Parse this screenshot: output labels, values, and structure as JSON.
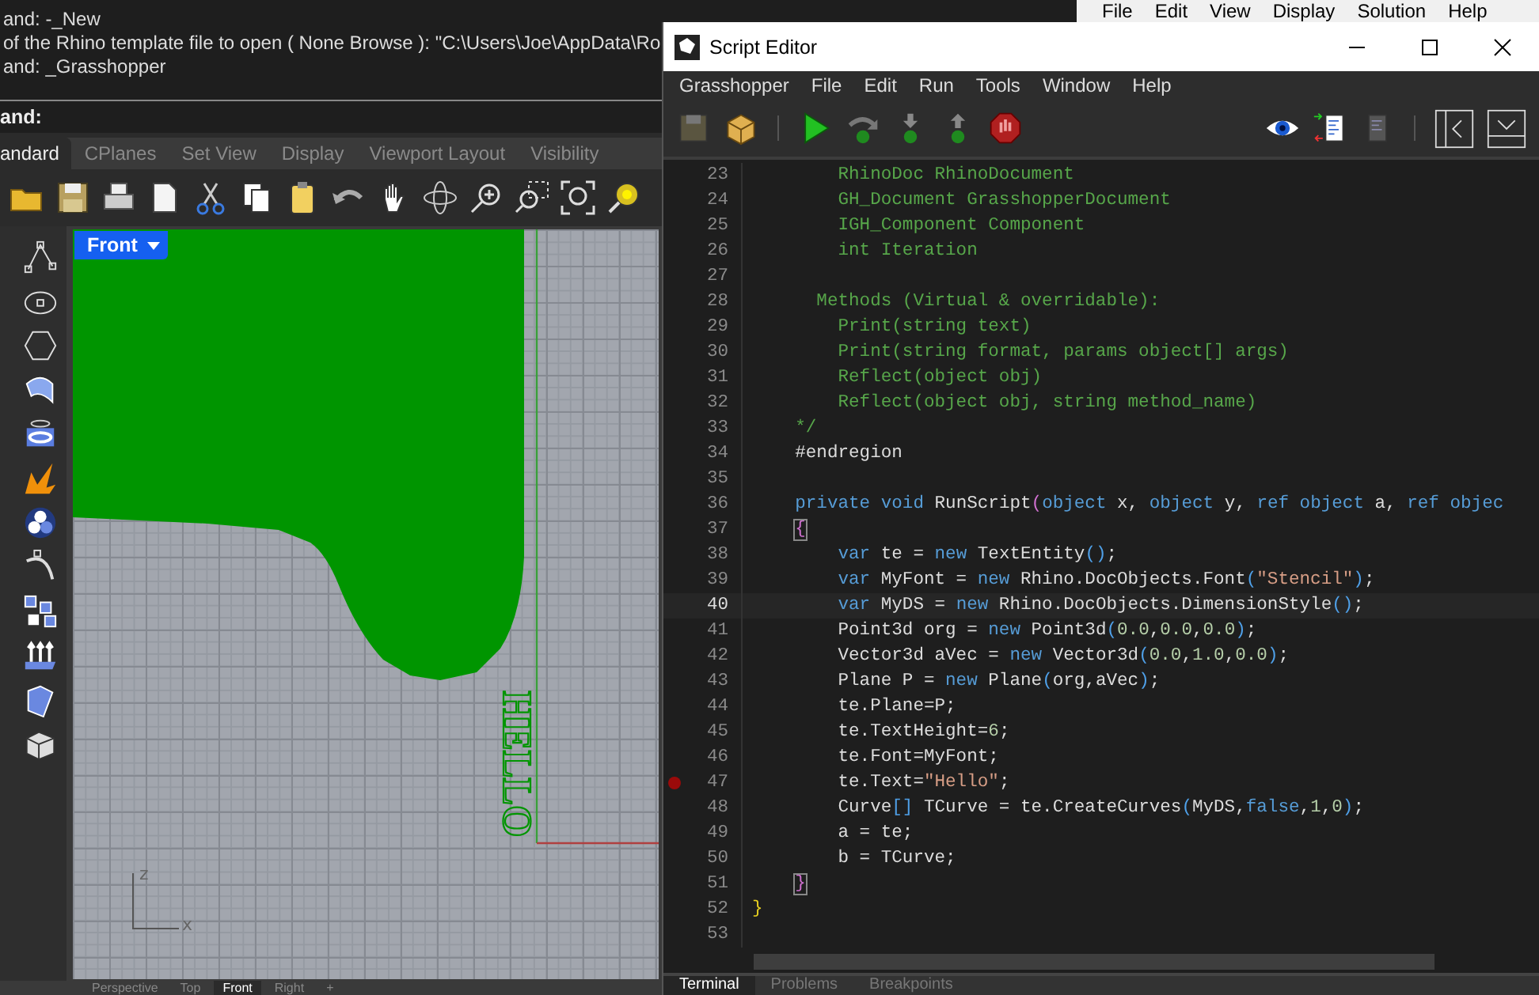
{
  "rhino": {
    "command_history": [
      "and: -_New",
      "of the Rhino template file to open ( None  Browse ): \"C:\\Users\\Joe\\AppData\\Ro",
      "and: _Grasshopper"
    ],
    "command_prompt": "and:",
    "toolbar_tabs": [
      {
        "label": "andard",
        "selected": true
      },
      {
        "label": "CPlanes",
        "selected": false
      },
      {
        "label": "Set View",
        "selected": false
      },
      {
        "label": "Display",
        "selected": false
      },
      {
        "label": "Viewport Layout",
        "selected": false
      },
      {
        "label": "Visibility",
        "selected": false
      }
    ],
    "viewport": {
      "label": "Front",
      "model_text": "HELLO",
      "axis_z": "z",
      "axis_x": "x"
    },
    "viewport_tabs": [
      {
        "label": "Perspective",
        "selected": false
      },
      {
        "label": "Top",
        "selected": false
      },
      {
        "label": "Front",
        "selected": true
      },
      {
        "label": "Right",
        "selected": false
      },
      {
        "label": "+",
        "selected": false
      }
    ]
  },
  "grasshopper_menu": [
    "File",
    "Edit",
    "View",
    "Display",
    "Solution",
    "Help"
  ],
  "script_editor": {
    "title": "Script Editor",
    "menu": [
      "Grasshopper",
      "File",
      "Edit",
      "Run",
      "Tools",
      "Window",
      "Help"
    ],
    "lines": [
      {
        "n": "23",
        "breakpoint": false,
        "current": false,
        "tokens": [
          {
            "kind": "comment",
            "text": "        RhinoDoc RhinoDocument"
          }
        ]
      },
      {
        "n": "24",
        "breakpoint": false,
        "current": false,
        "tokens": [
          {
            "kind": "comment",
            "text": "        GH_Document GrasshopperDocument"
          }
        ]
      },
      {
        "n": "25",
        "breakpoint": false,
        "current": false,
        "tokens": [
          {
            "kind": "comment",
            "text": "        IGH_Component Component"
          }
        ]
      },
      {
        "n": "26",
        "breakpoint": false,
        "current": false,
        "tokens": [
          {
            "kind": "comment",
            "text": "        int Iteration"
          }
        ]
      },
      {
        "n": "27",
        "breakpoint": false,
        "current": false
      },
      {
        "n": "28",
        "breakpoint": false,
        "current": false,
        "tokens": [
          {
            "kind": "comment",
            "text": "      Methods (Virtual & overridable):"
          }
        ]
      },
      {
        "n": "29",
        "breakpoint": false,
        "current": false,
        "tokens": [
          {
            "kind": "comment",
            "text": "        Print(string text)"
          }
        ]
      },
      {
        "n": "30",
        "breakpoint": false,
        "current": false,
        "tokens": [
          {
            "kind": "comment",
            "text": "        Print(string format, params object[] args)"
          }
        ]
      },
      {
        "n": "31",
        "breakpoint": false,
        "current": false,
        "tokens": [
          {
            "kind": "comment",
            "text": "        Reflect(object obj)"
          }
        ]
      },
      {
        "n": "32",
        "breakpoint": false,
        "current": false,
        "tokens": [
          {
            "kind": "comment",
            "text": "        Reflect(object obj, string method_name)"
          }
        ]
      },
      {
        "n": "33",
        "breakpoint": false,
        "current": false,
        "tokens": [
          {
            "kind": "comment",
            "text": "    */"
          }
        ]
      },
      {
        "n": "34",
        "breakpoint": false,
        "current": false,
        "tokens": [
          {
            "kind": "plain",
            "text": "    #endregion"
          }
        ]
      },
      {
        "n": "35",
        "breakpoint": false,
        "current": false
      },
      {
        "n": "36",
        "breakpoint": false,
        "current": false,
        "tokens": [
          {
            "kind": "keyword",
            "text": "    private"
          },
          {
            "kind": "keyword",
            "text": " void"
          },
          {
            "kind": "plain",
            "text": " RunScript"
          },
          {
            "kind": "paren",
            "text": "("
          },
          {
            "kind": "keyword",
            "text": "object"
          },
          {
            "kind": "plain",
            "text": " x, "
          },
          {
            "kind": "keyword",
            "text": "object"
          },
          {
            "kind": "plain",
            "text": " y, "
          },
          {
            "kind": "keyword",
            "text": "ref"
          },
          {
            "kind": "keyword",
            "text": " object"
          },
          {
            "kind": "plain",
            "text": " a, "
          },
          {
            "kind": "keyword",
            "text": "ref"
          },
          {
            "kind": "keyword",
            "text": " objec"
          }
        ]
      },
      {
        "n": "37",
        "breakpoint": false,
        "current": false,
        "tokens": [
          {
            "kind": "brace",
            "text": "{"
          }
        ]
      },
      {
        "n": "38",
        "breakpoint": false,
        "current": false,
        "tokens": [
          {
            "kind": "keyword",
            "text": "        var"
          },
          {
            "kind": "plain",
            "text": " te = "
          },
          {
            "kind": "keyword",
            "text": "new"
          },
          {
            "kind": "plain",
            "text": " TextEntity"
          },
          {
            "kind": "punct",
            "text": "()"
          },
          {
            "kind": "plain",
            "text": ";"
          }
        ]
      },
      {
        "n": "39",
        "breakpoint": false,
        "current": false,
        "tokens": [
          {
            "kind": "keyword",
            "text": "        var"
          },
          {
            "kind": "plain",
            "text": " MyFont = "
          },
          {
            "kind": "keyword",
            "text": "new"
          },
          {
            "kind": "plain",
            "text": " Rhino.DocObjects.Font"
          },
          {
            "kind": "punct",
            "text": "("
          },
          {
            "kind": "string",
            "text": "\"Stencil\""
          },
          {
            "kind": "punct",
            "text": ")"
          },
          {
            "kind": "plain",
            "text": ";"
          }
        ]
      },
      {
        "n": "40",
        "breakpoint": false,
        "current": true,
        "tokens": [
          {
            "kind": "keyword",
            "text": "        var"
          },
          {
            "kind": "plain",
            "text": " MyDS = "
          },
          {
            "kind": "keyword",
            "text": "new"
          },
          {
            "kind": "plain",
            "text": " Rhino.DocObjects.DimensionStyle"
          },
          {
            "kind": "punct",
            "text": "()"
          },
          {
            "kind": "plain",
            "text": ";"
          }
        ]
      },
      {
        "n": "41",
        "breakpoint": false,
        "current": false,
        "tokens": [
          {
            "kind": "plain",
            "text": "        Point3d org = "
          },
          {
            "kind": "keyword",
            "text": "new"
          },
          {
            "kind": "plain",
            "text": " Point3d"
          },
          {
            "kind": "punct",
            "text": "("
          },
          {
            "kind": "number",
            "text": "0.0"
          },
          {
            "kind": "plain",
            "text": ","
          },
          {
            "kind": "number",
            "text": "0.0"
          },
          {
            "kind": "plain",
            "text": ","
          },
          {
            "kind": "number",
            "text": "0.0"
          },
          {
            "kind": "punct",
            "text": ")"
          },
          {
            "kind": "plain",
            "text": ";"
          }
        ]
      },
      {
        "n": "42",
        "breakpoint": false,
        "current": false,
        "tokens": [
          {
            "kind": "plain",
            "text": "        Vector3d aVec = "
          },
          {
            "kind": "keyword",
            "text": "new"
          },
          {
            "kind": "plain",
            "text": " Vector3d"
          },
          {
            "kind": "punct",
            "text": "("
          },
          {
            "kind": "number",
            "text": "0.0"
          },
          {
            "kind": "plain",
            "text": ","
          },
          {
            "kind": "number",
            "text": "1.0"
          },
          {
            "kind": "plain",
            "text": ","
          },
          {
            "kind": "number",
            "text": "0.0"
          },
          {
            "kind": "punct",
            "text": ")"
          },
          {
            "kind": "plain",
            "text": ";"
          }
        ]
      },
      {
        "n": "43",
        "breakpoint": false,
        "current": false,
        "tokens": [
          {
            "kind": "plain",
            "text": "        Plane P = "
          },
          {
            "kind": "keyword",
            "text": "new"
          },
          {
            "kind": "plain",
            "text": " Plane"
          },
          {
            "kind": "punct",
            "text": "("
          },
          {
            "kind": "plain",
            "text": "org,aVec"
          },
          {
            "kind": "punct",
            "text": ")"
          },
          {
            "kind": "plain",
            "text": ";"
          }
        ]
      },
      {
        "n": "44",
        "breakpoint": false,
        "current": false,
        "tokens": [
          {
            "kind": "plain",
            "text": "        te.Plane=P;"
          }
        ]
      },
      {
        "n": "45",
        "breakpoint": false,
        "current": false,
        "tokens": [
          {
            "kind": "plain",
            "text": "        te.TextHeight="
          },
          {
            "kind": "number",
            "text": "6"
          },
          {
            "kind": "plain",
            "text": ";"
          }
        ]
      },
      {
        "n": "46",
        "breakpoint": false,
        "current": false,
        "tokens": [
          {
            "kind": "plain",
            "text": "        te.Font=MyFont;"
          }
        ]
      },
      {
        "n": "47",
        "breakpoint": true,
        "current": false,
        "tokens": [
          {
            "kind": "plain",
            "text": "        te.Text="
          },
          {
            "kind": "string",
            "text": "\"Hello\""
          },
          {
            "kind": "plain",
            "text": ";"
          }
        ]
      },
      {
        "n": "48",
        "breakpoint": false,
        "current": false,
        "tokens": [
          {
            "kind": "plain",
            "text": "        Curve"
          },
          {
            "kind": "punct",
            "text": "[]"
          },
          {
            "kind": "plain",
            "text": " TCurve = te.CreateCurves"
          },
          {
            "kind": "punct",
            "text": "("
          },
          {
            "kind": "plain",
            "text": "MyDS,"
          },
          {
            "kind": "keyword",
            "text": "false"
          },
          {
            "kind": "plain",
            "text": ","
          },
          {
            "kind": "number",
            "text": "1"
          },
          {
            "kind": "plain",
            "text": ","
          },
          {
            "kind": "number",
            "text": "0"
          },
          {
            "kind": "punct",
            "text": ")"
          },
          {
            "kind": "plain",
            "text": ";"
          }
        ]
      },
      {
        "n": "49",
        "breakpoint": false,
        "current": false,
        "tokens": [
          {
            "kind": "plain",
            "text": "        a = te;"
          }
        ]
      },
      {
        "n": "50",
        "breakpoint": false,
        "current": false,
        "tokens": [
          {
            "kind": "plain",
            "text": "        b = TCurve;"
          }
        ]
      },
      {
        "n": "51",
        "breakpoint": false,
        "current": false,
        "tokens": [
          {
            "kind": "brace",
            "text": "}"
          }
        ]
      },
      {
        "n": "52",
        "breakpoint": false,
        "current": false,
        "tokens": [
          {
            "kind": "rootbrace",
            "text": "}"
          }
        ]
      },
      {
        "n": "53",
        "breakpoint": false,
        "current": false
      }
    ],
    "panel_tabs": [
      {
        "label": "Terminal",
        "selected": true
      },
      {
        "label": "Problems",
        "selected": false
      },
      {
        "label": "Breakpoints",
        "selected": false
      }
    ]
  }
}
